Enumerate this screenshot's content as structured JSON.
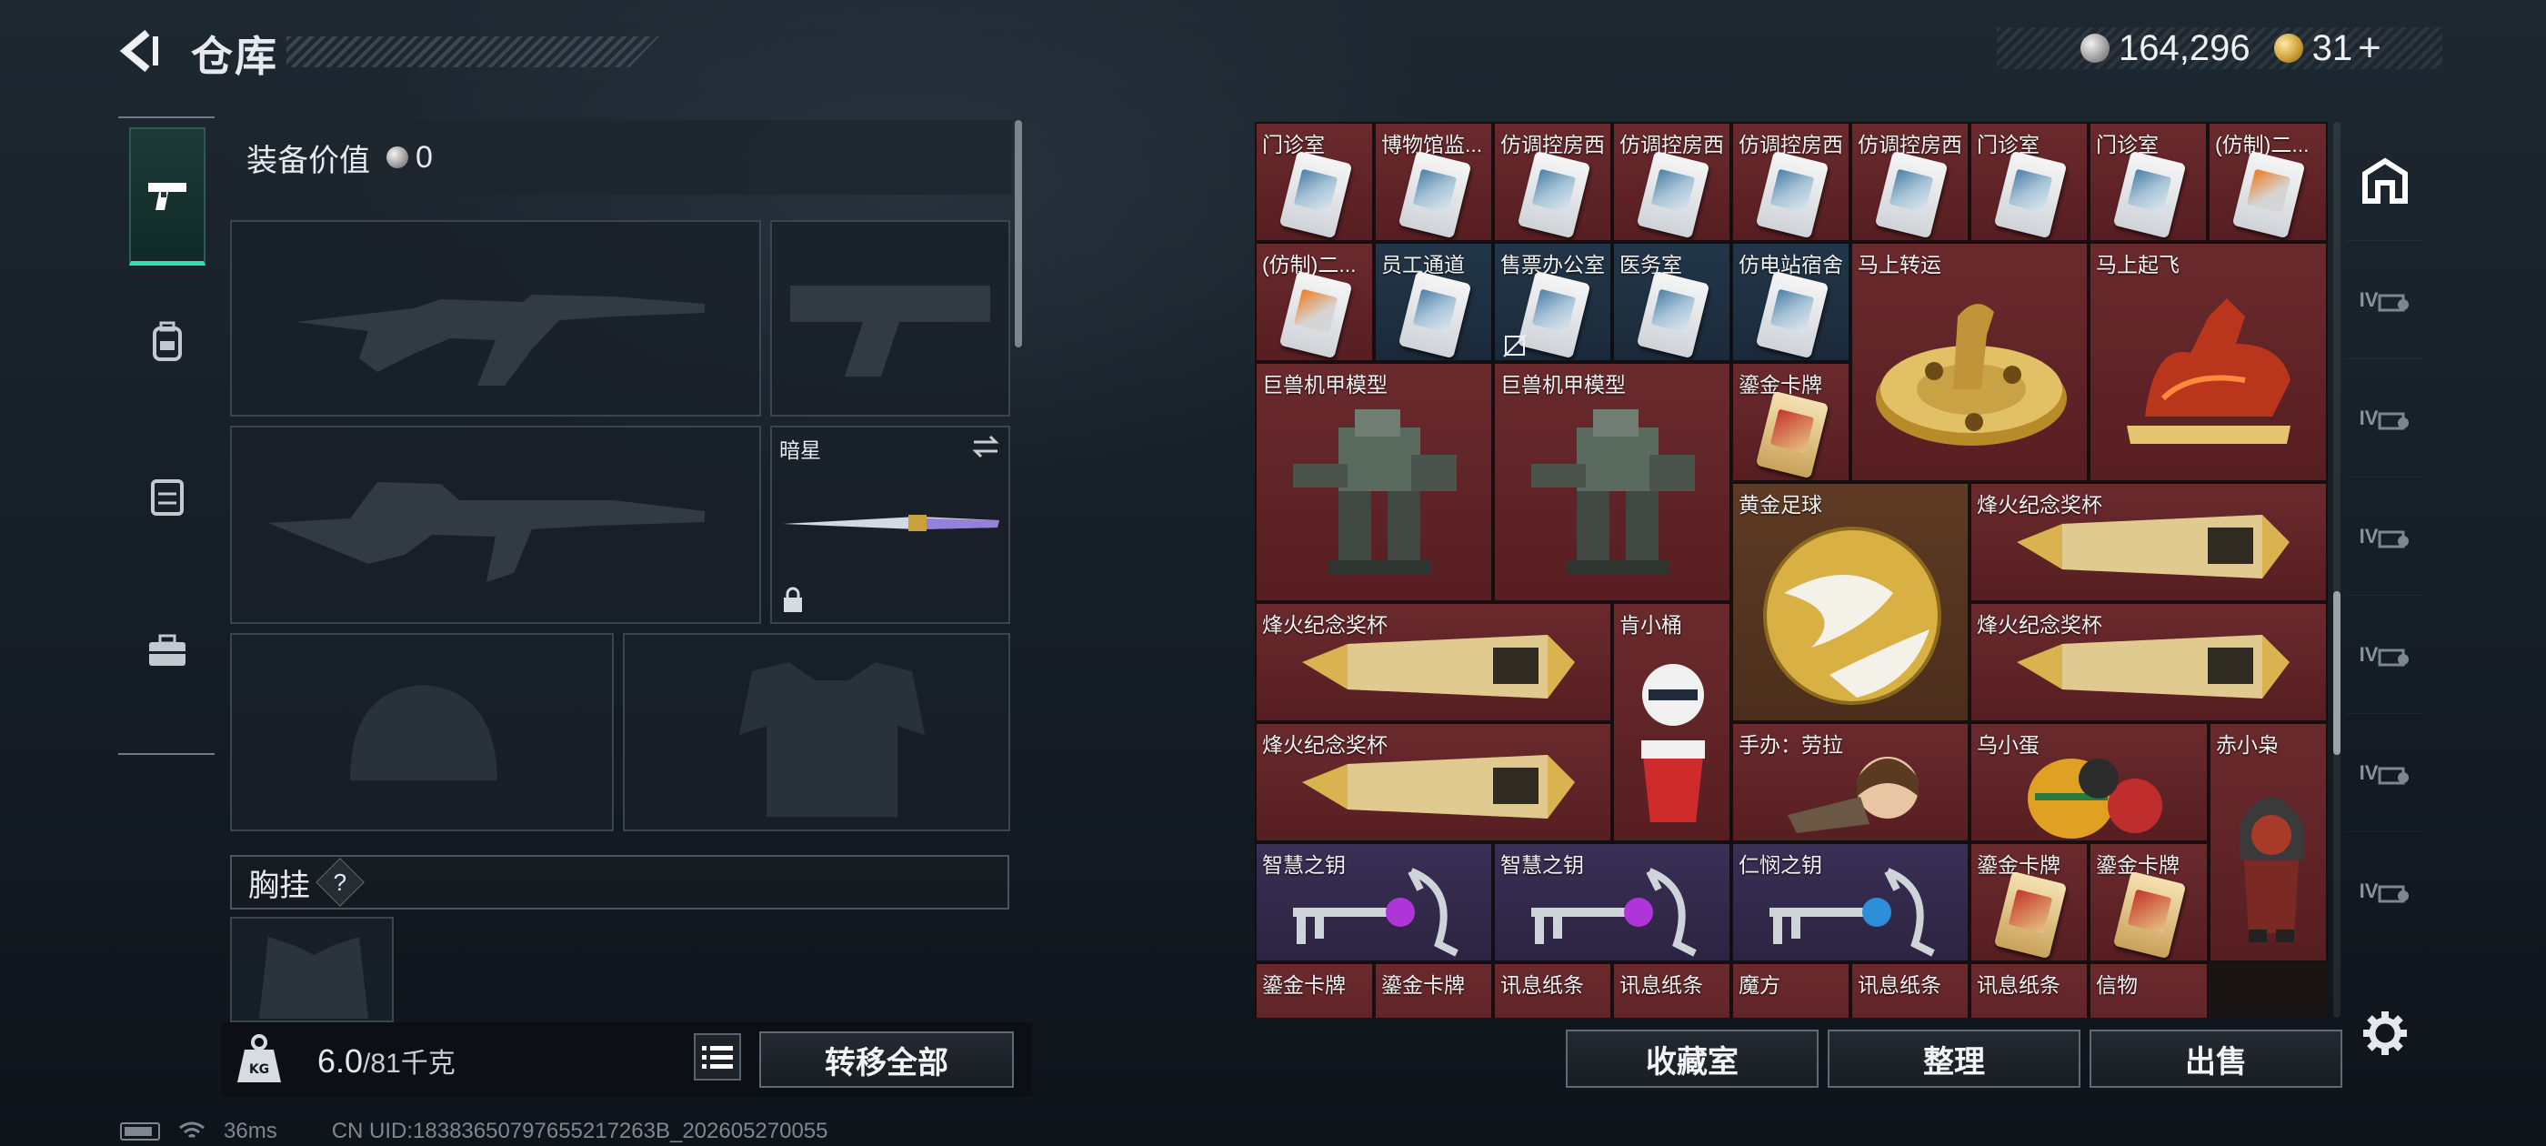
{
  "header": {
    "title": "仓库",
    "currency_silver": "164,296",
    "currency_gold": "31",
    "plus": "+"
  },
  "left": {
    "equip_value_label": "装备价值",
    "equip_value": "0",
    "melee_name": "暗星",
    "chest_label": "胸挂",
    "help": "?",
    "weight_value": "6.0",
    "weight_max": "/81千克",
    "transfer_all": "转移全部"
  },
  "grid": {
    "row1": [
      "门诊室",
      "博物馆监...",
      "仿调控房西",
      "仿调控房西",
      "仿调控房西",
      "仿调控房西",
      "门诊室",
      "门诊室",
      "(仿制)二..."
    ],
    "row2": [
      "(仿制)二...",
      "员工通道",
      "售票办公室",
      "医务室",
      "仿电站宿舍"
    ],
    "ma_shang_zhuan_yun": "马上转运",
    "ma_shang_qi_fei": "马上起飞",
    "mecha_1": "巨兽机甲模型",
    "mecha_2": "巨兽机甲模型",
    "gold_card_1": "鎏金卡牌",
    "golden_ball": "黄金足球",
    "trophy_1": "烽火纪念奖杯",
    "trophy_2": "烽火纪念奖杯",
    "kfc": "肯小桶",
    "trophy_3": "烽火纪念奖杯",
    "trophy_4": "烽火纪念奖杯",
    "figure_laura": "手办：劳拉",
    "crow_egg": "乌小蛋",
    "red_owl": "赤小枭",
    "key_1": "智慧之钥",
    "key_2": "智慧之钥",
    "key_3": "仁悯之钥",
    "gold_card_2": "鎏金卡牌",
    "gold_card_3": "鎏金卡牌",
    "row_bottom": [
      "鎏金卡牌",
      "鎏金卡牌",
      "讯息纸条",
      "讯息纸条",
      "魔方",
      "讯息纸条",
      "讯息纸条",
      "信物"
    ]
  },
  "actions": {
    "collection": "收藏室",
    "sort": "整理",
    "sell": "出售"
  },
  "right_tabs": [
    "IV",
    "IV",
    "IV",
    "IV",
    "IV",
    "IV"
  ],
  "status": {
    "ping": "36ms",
    "uid": "CN UID:18383650797655217263B_202605270055"
  },
  "colors": {
    "accent": "#2fe0b5",
    "red_tier": "#6a2a2d",
    "gold_tier": "#5e3b24",
    "blue_tier": "#223649",
    "purple_tier": "#3a2f55"
  }
}
